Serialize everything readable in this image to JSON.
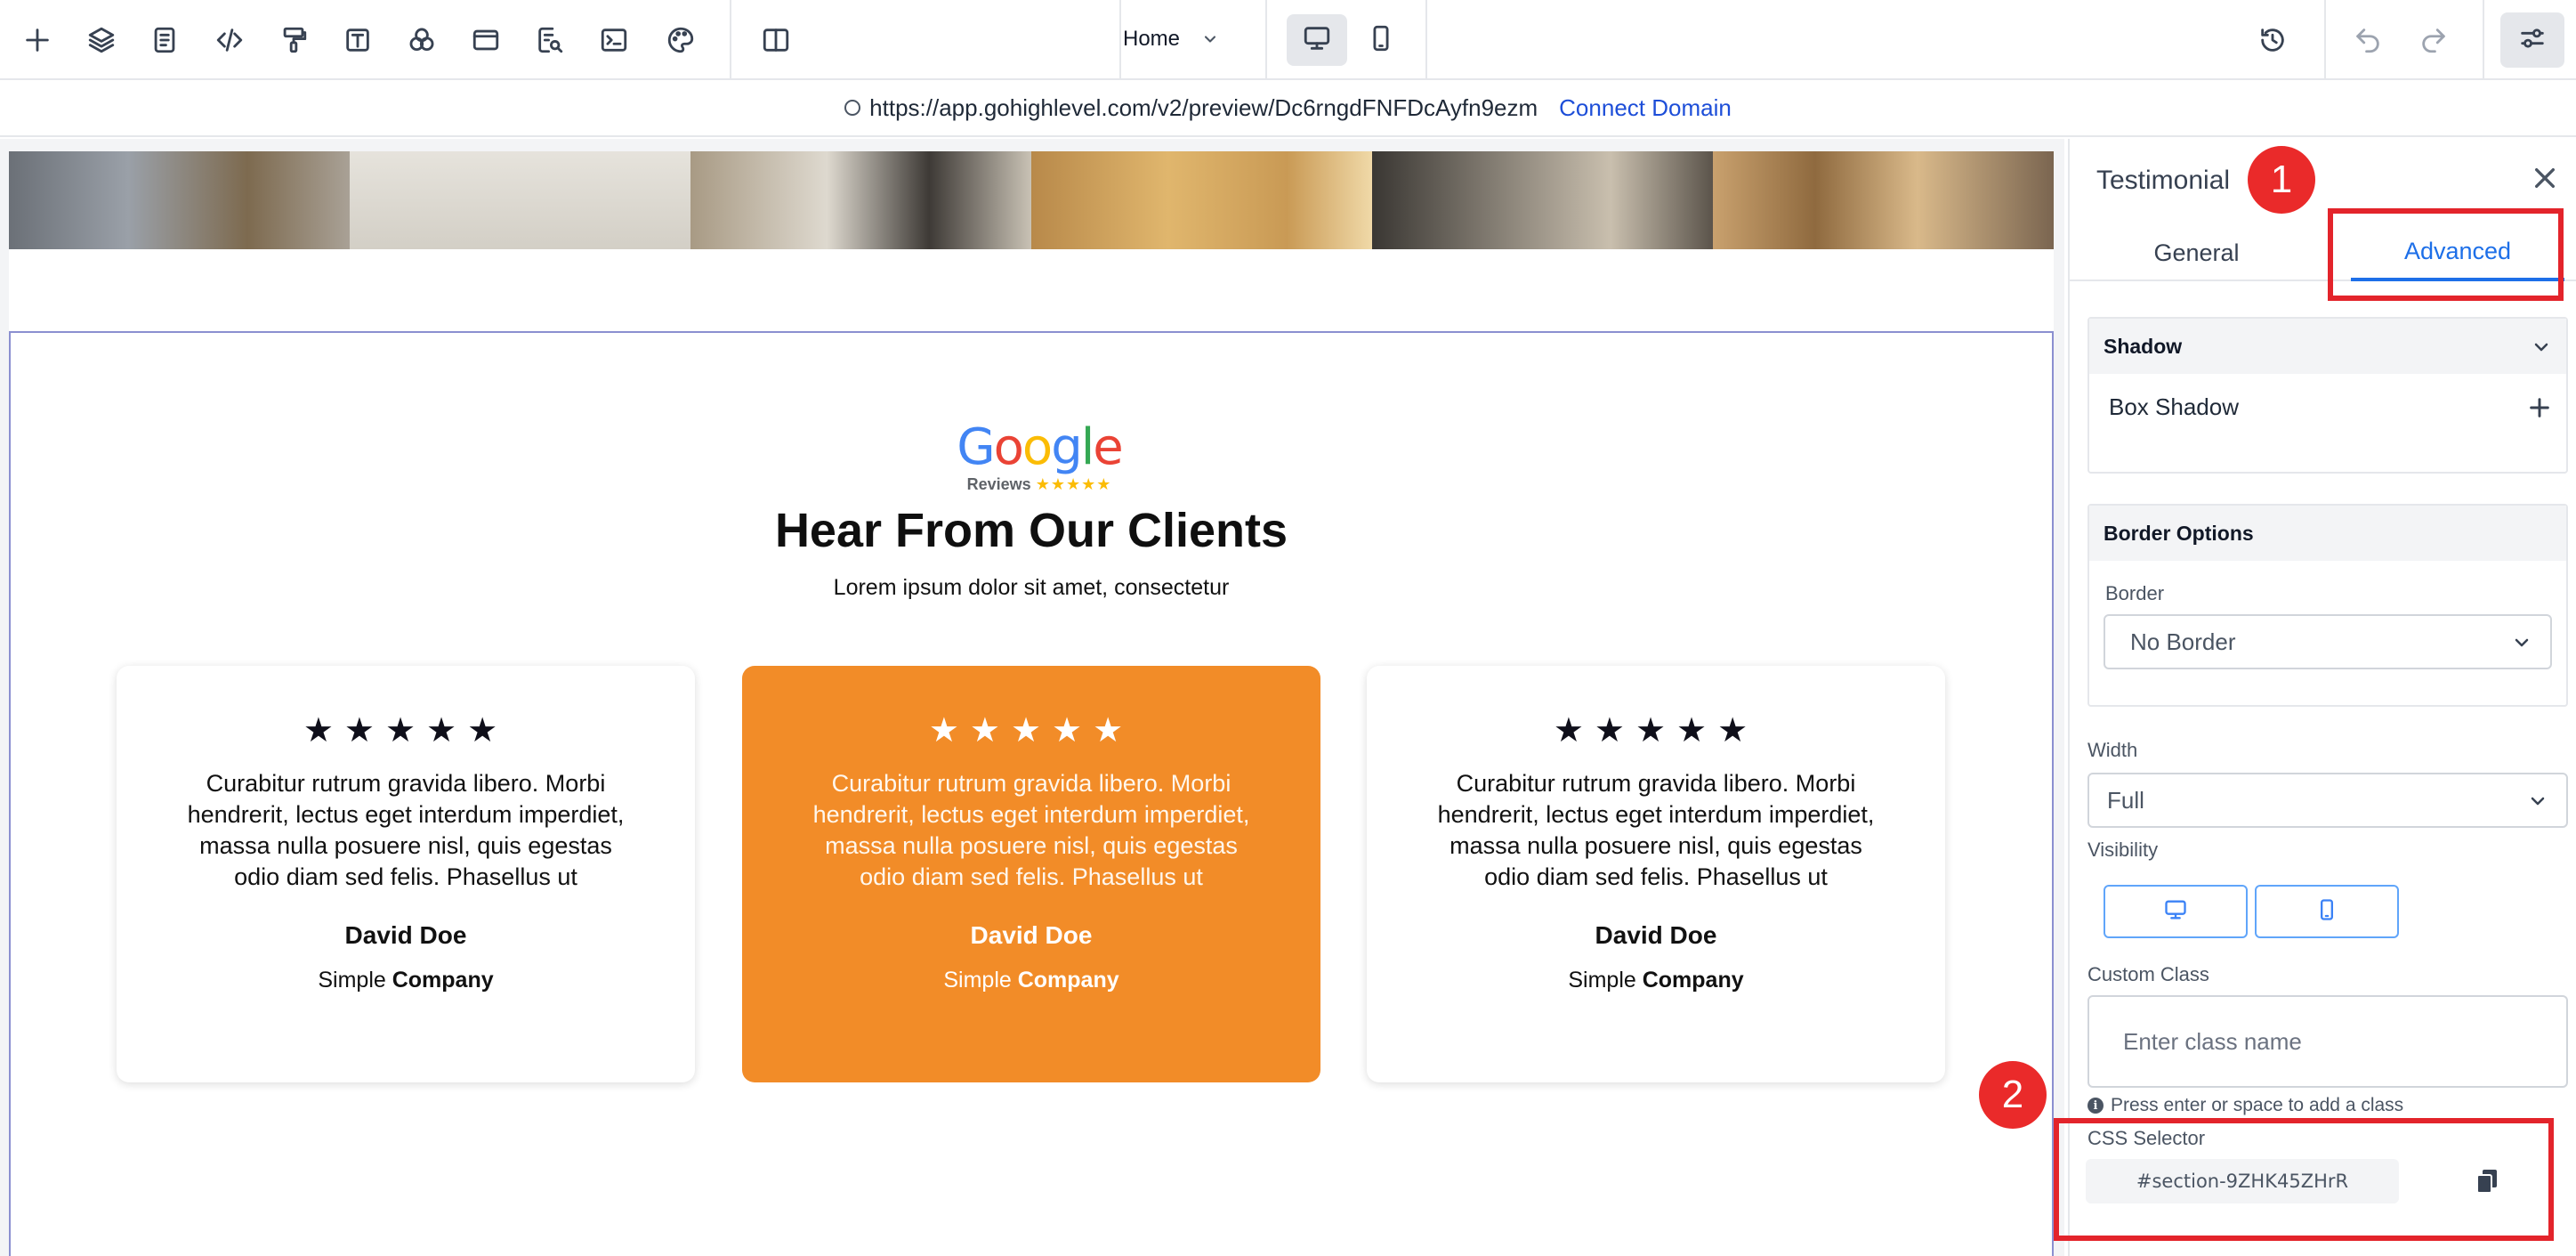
{
  "toolbar": {
    "icons": [
      "plus-icon",
      "layers-icon",
      "pages-icon",
      "code-icon",
      "paint-roller-icon",
      "text-icon",
      "elements-icon",
      "section-icon",
      "seo-icon",
      "terminal-icon",
      "palette-icon",
      "split-view-icon"
    ],
    "page_selector": "Home",
    "devices": [
      "desktop-icon",
      "mobile-icon"
    ]
  },
  "urlbar": {
    "url": "https://app.gohighlevel.com/v2/preview/Dc6rngdFNFDcAyfn9ezm",
    "connect_label": "Connect Domain"
  },
  "canvas": {
    "photo_colors": [
      "#8a8f96",
      "#d9d6cf",
      "#b8a98e",
      "#c9a15a",
      "#6f6a63",
      "#b78b52"
    ],
    "logo": {
      "word": "Google",
      "sub": "Reviews",
      "sub_stars": "★★★★★"
    },
    "title": "Hear From Our Clients",
    "subtitle": "Lorem ipsum dolor sit amet, consectetur",
    "cards": [
      {
        "stars": "★★★★★",
        "quote": "Curabitur rutrum gravida libero. Morbi hendrerit, lectus eget interdum imperdiet, massa nulla posuere nisl, quis egestas odio diam sed felis. Phasellus ut",
        "name": "David Doe",
        "company_prefix": "Simple",
        "company_bold": "Company"
      },
      {
        "stars": "★★★★★",
        "quote": "Curabitur rutrum gravida libero. Morbi hendrerit, lectus eget interdum imperdiet, massa nulla posuere nisl, quis egestas odio diam sed felis. Phasellus ut",
        "name": "David Doe",
        "company_prefix": "Simple",
        "company_bold": "Company"
      },
      {
        "stars": "★★★★★",
        "quote": "Curabitur rutrum gravida libero. Morbi hendrerit, lectus eget interdum imperdiet, massa nulla posuere nisl, quis egestas odio diam sed felis. Phasellus ut",
        "name": "David Doe",
        "company_prefix": "Simple",
        "company_bold": "Company"
      }
    ],
    "featured_color": "#f28c28"
  },
  "panel": {
    "title": "Testimonial",
    "tabs": {
      "general": "General",
      "advanced": "Advanced"
    },
    "shadow": {
      "header": "Shadow",
      "box_shadow": "Box Shadow"
    },
    "border_options": {
      "header": "Border Options",
      "border_label": "Border",
      "border_value": "No Border"
    },
    "width": {
      "label": "Width",
      "value": "Full"
    },
    "visibility": {
      "label": "Visibility"
    },
    "custom_class": {
      "label": "Custom Class",
      "placeholder": "Enter class name",
      "hint": "Press enter or space to add a class"
    },
    "css_selector": {
      "label": "CSS Selector",
      "value": "#section-9ZHK45ZHrR"
    }
  },
  "annotations": {
    "badge_1": "1",
    "badge_2": "2",
    "highlight_color": "#e3242b"
  }
}
